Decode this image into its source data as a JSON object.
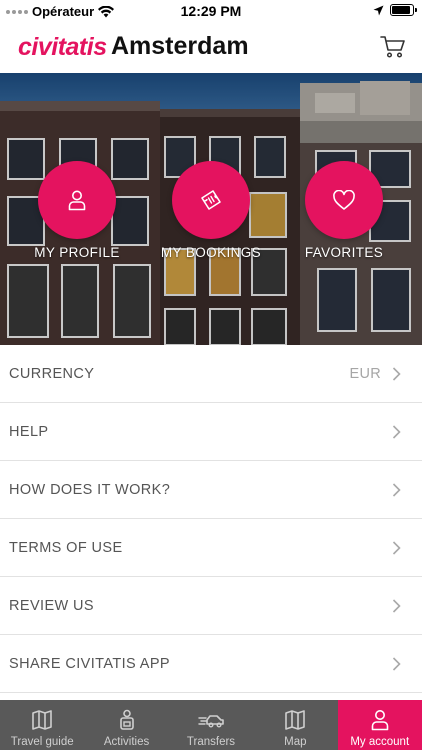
{
  "status_bar": {
    "carrier": "Opérateur",
    "time": "12:29 PM",
    "battery_level": 0.9,
    "icons": [
      "wifi-icon",
      "location-arrow-icon",
      "battery-icon"
    ]
  },
  "header": {
    "brand": "civitatis",
    "city": "Amsterdam",
    "cart_icon": "cart-icon"
  },
  "hero": {
    "actions": [
      {
        "label": "MY PROFILE",
        "icon": "user-icon"
      },
      {
        "label": "MY BOOKINGS",
        "icon": "ticket-icon"
      },
      {
        "label": "FAVORITES",
        "icon": "heart-icon"
      }
    ]
  },
  "menu": {
    "items": [
      {
        "label": "CURRENCY",
        "value": "EUR"
      },
      {
        "label": "HELP",
        "value": ""
      },
      {
        "label": "HOW DOES IT WORK?",
        "value": ""
      },
      {
        "label": "TERMS OF USE",
        "value": ""
      },
      {
        "label": "REVIEW US",
        "value": ""
      },
      {
        "label": "SHARE CIVITATIS APP",
        "value": ""
      }
    ]
  },
  "tab_bar": {
    "tabs": [
      {
        "label": "Travel guide",
        "icon": "map-book-icon"
      },
      {
        "label": "Activities",
        "icon": "activities-icon"
      },
      {
        "label": "Transfers",
        "icon": "transfer-car-icon"
      },
      {
        "label": "Map",
        "icon": "map-icon"
      },
      {
        "label": "My account",
        "icon": "user-icon",
        "active": true
      }
    ]
  },
  "colors": {
    "accent": "#e4135f",
    "tab_bar_bg": "#595959"
  }
}
